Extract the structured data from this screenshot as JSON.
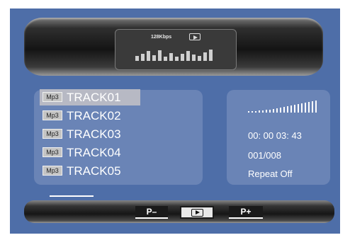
{
  "display": {
    "bitrate": "128Kbps",
    "state_icon": "play-icon"
  },
  "tracks": [
    {
      "format": "Mp3",
      "name": "TRACK01",
      "selected": true
    },
    {
      "format": "Mp3",
      "name": "TRACK02",
      "selected": false
    },
    {
      "format": "Mp3",
      "name": "TRACK03",
      "selected": false
    },
    {
      "format": "Mp3",
      "name": "TRACK04",
      "selected": false
    },
    {
      "format": "Mp3",
      "name": "TRACK05",
      "selected": false
    }
  ],
  "status": {
    "volume_icon": "volume-bars-icon",
    "time": "00: 00 03: 43",
    "track_index": "001/008",
    "repeat": "Repeat Off"
  },
  "controls": {
    "prev_label": "P–",
    "play_icon": "play-icon",
    "next_label": "P+"
  },
  "colors": {
    "background": "#4e6ea8",
    "panel": "#6a84b6",
    "selected_row": "#b7b9c4",
    "text": "#ffffff"
  }
}
